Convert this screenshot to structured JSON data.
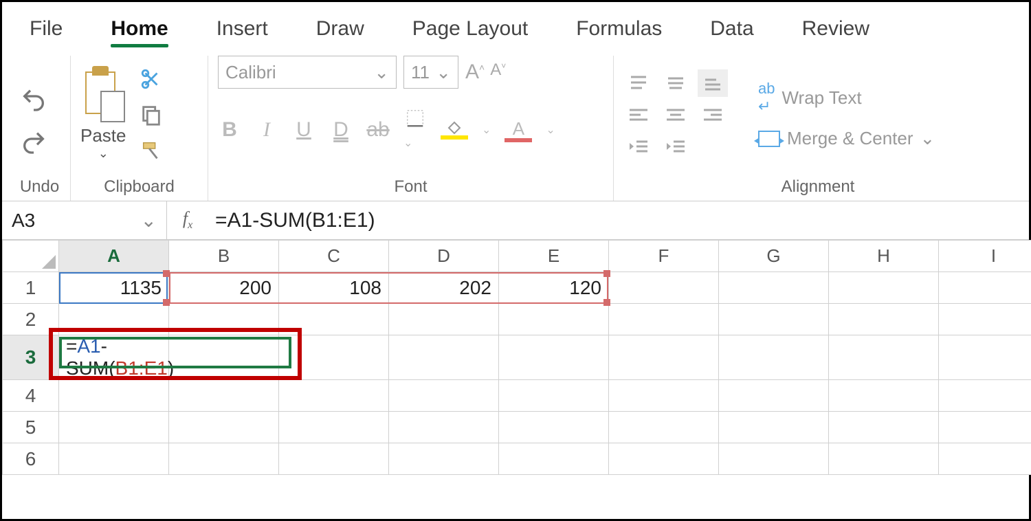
{
  "tabs": {
    "file": "File",
    "home": "Home",
    "insert": "Insert",
    "draw": "Draw",
    "page_layout": "Page Layout",
    "formulas": "Formulas",
    "data": "Data",
    "review": "Review",
    "active": "home"
  },
  "ribbon": {
    "undo": {
      "label": "Undo"
    },
    "clipboard": {
      "label": "Clipboard",
      "paste": "Paste"
    },
    "font": {
      "label": "Font",
      "name": "Calibri",
      "size": "11",
      "bold": "B",
      "italic": "I",
      "underline": "U",
      "double_underline": "D",
      "strike": "ab"
    },
    "alignment": {
      "label": "Alignment",
      "wrap": "Wrap Text",
      "merge": "Merge & Center"
    }
  },
  "formula_bar": {
    "name_box": "A3",
    "fx": "fx",
    "formula": "=A1-SUM(B1:E1)"
  },
  "grid": {
    "columns": [
      "A",
      "B",
      "C",
      "D",
      "E",
      "F",
      "G",
      "H",
      "I"
    ],
    "rows": [
      "1",
      "2",
      "3",
      "4",
      "5",
      "6"
    ],
    "active_col": "A",
    "active_row": "3",
    "cells": {
      "A1": "1135",
      "B1": "200",
      "C1": "108",
      "D1": "202",
      "E1": "120"
    },
    "edit_cell": {
      "prefix": "=",
      "ref1": "A1",
      "mid": "-SUM(",
      "ref2": "B1:E1",
      "suffix": ")"
    }
  }
}
